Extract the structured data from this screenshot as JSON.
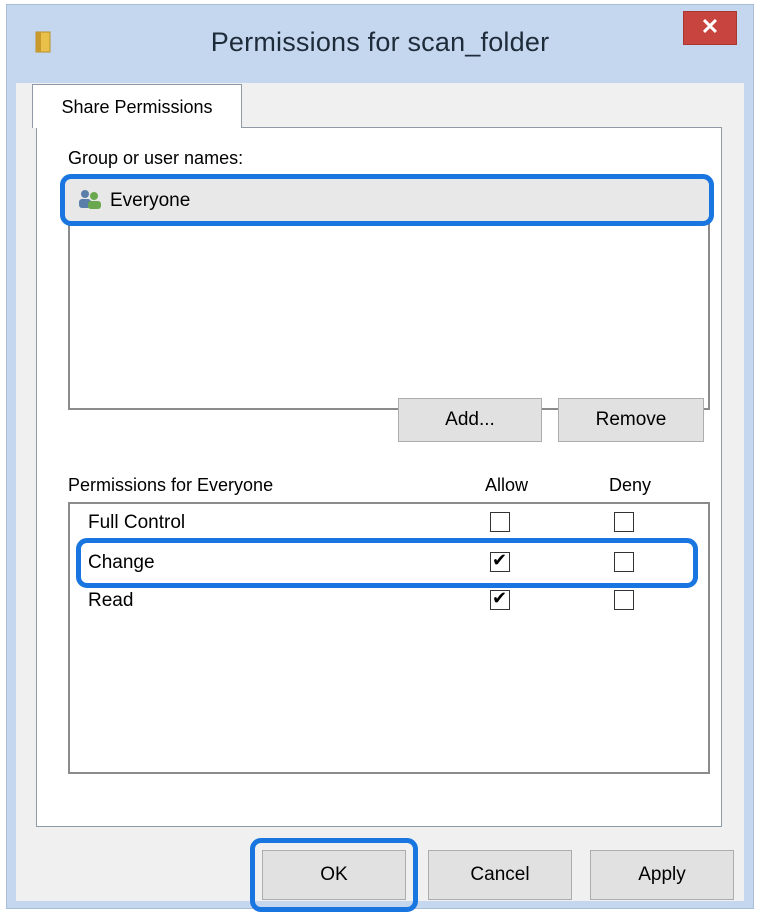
{
  "window": {
    "title": "Permissions for scan_folder",
    "close_glyph": "✕",
    "icon": "folder-icon"
  },
  "tabs": [
    "Share Permissions"
  ],
  "groups": {
    "label": "Group or user names:",
    "items": [
      {
        "name": "Everyone",
        "icon": "users-group-icon",
        "selected": true
      }
    ]
  },
  "buttons": {
    "add": "Add...",
    "remove": "Remove",
    "ok": "OK",
    "cancel": "Cancel",
    "apply": "Apply"
  },
  "permissions": {
    "label": "Permissions for Everyone",
    "allow_header": "Allow",
    "deny_header": "Deny",
    "rows": [
      {
        "name": "Full Control",
        "allow": false,
        "deny": false
      },
      {
        "name": "Change",
        "allow": true,
        "deny": false
      },
      {
        "name": "Read",
        "allow": true,
        "deny": false
      }
    ]
  },
  "colors": {
    "highlight": "#1976e0",
    "close_button": "#c7453e",
    "frame": "#c5d7ee"
  }
}
